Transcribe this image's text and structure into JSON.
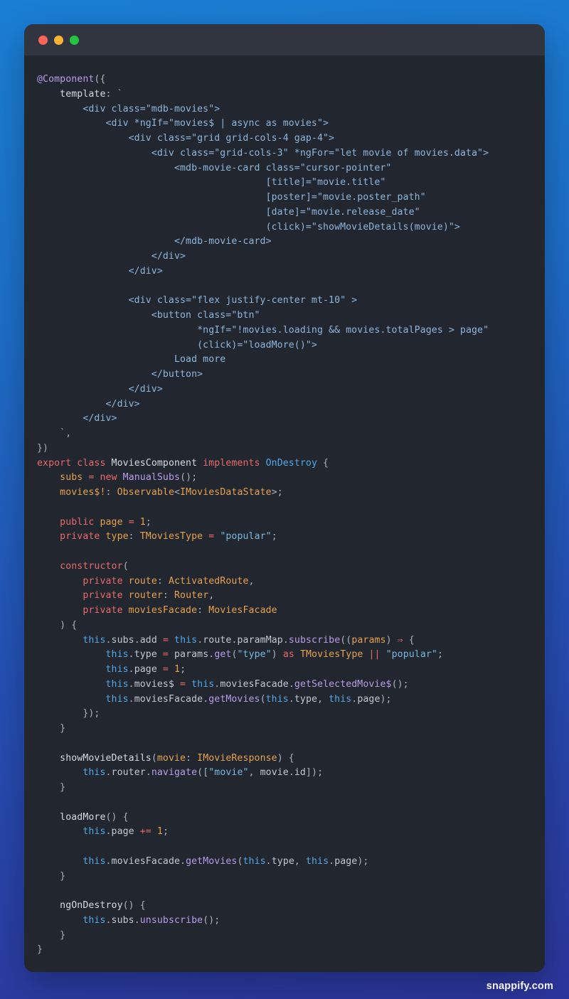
{
  "window": {
    "traffic_lights": [
      {
        "name": "close",
        "color": "#f9655b"
      },
      {
        "name": "minimize",
        "color": "#fab431"
      },
      {
        "name": "maximize",
        "color": "#23c442"
      }
    ]
  },
  "watermark": {
    "text": "snappify.com"
  },
  "theme": {
    "background_top": "#1a7fd4",
    "background_bottom": "#2c359b",
    "card_background": "#22262f",
    "titlebar_background": "#31353f",
    "markup_color": "#8eb6dd",
    "keyword_color": "#e86b6b",
    "class_color": "#52a8e8",
    "variable_color": "#e5a250",
    "function_color": "#b99ce8",
    "string_color": "#79b8e0",
    "plain_color": "#c2c8d4"
  },
  "code": {
    "language": "typescript",
    "filename_hint": "movies.component.ts",
    "plain_text": "@Component({\n    template: `\n        <div class=\"mdb-movies\">\n            <div *ngIf=\"movies$ | async as movies\">\n                <div class=\"grid grid-cols-4 gap-4\">\n                    <div class=\"grid-cols-3\" *ngFor=\"let movie of movies.data\">\n                        <mdb-movie-card class=\"cursor-pointer\"\n                                        [title]=\"movie.title\"\n                                        [poster]=\"movie.poster_path\"\n                                        [date]=\"movie.release_date\"\n                                        (click)=\"showMovieDetails(movie)\">\n                        </mdb-movie-card>\n                    </div>\n                </div>\n\n                <div class=\"flex justify-center mt-10\" >\n                    <button class=\"btn\"\n                            *ngIf=\"!movies.loading && movies.totalPages > page\"\n                            (click)=\"loadMore()\">\n                        Load more\n                    </button>\n                </div>\n            </div>\n        </div>\n    `,\n})\nexport class MoviesComponent implements OnDestroy {\n    subs = new ManualSubs();\n    movies$!: Observable<IMoviesDataState>;\n\n    public page = 1;\n    private type: TMoviesType = \"popular\";\n\n    constructor(\n        private route: ActivatedRoute,\n        private router: Router,\n        private moviesFacade: MoviesFacade\n    ) {\n        this.subs.add = this.route.paramMap.subscribe((params) => {\n            this.type = params.get(\"type\") as TMoviesType || \"popular\";\n            this.page = 1;\n            this.movies$ = this.moviesFacade.getSelectedMovie$();\n            this.moviesFacade.getMovies(this.type, this.page);\n        });\n    }\n\n    showMovieDetails(movie: IMovieResponse) {\n        this.router.navigate([\"movie\", movie.id]);\n    }\n\n    loadMore() {\n        this.page += 1;\n\n        this.moviesFacade.getMovies(this.type, this.page);\n    }\n\n    ngOnDestroy() {\n        this.subs.unsubscribe();\n    }\n}",
    "highlighted_html": "<span class=\"t-fn\">@Component</span><span class=\"t-punc\">({</span>\n    <span class=\"t-def\">template</span><span class=\"t-punc\">:</span> <span class=\"t-str\">`</span>\n        <span class=\"t-html\">&lt;div class=\"mdb-movies\"&gt;</span>\n            <span class=\"t-html\">&lt;div *ngIf=\"movies$ | async as movies\"&gt;</span>\n                <span class=\"t-html\">&lt;div class=\"grid grid-cols-4 gap-4\"&gt;</span>\n                    <span class=\"t-html\">&lt;div class=\"grid-cols-3\" *ngFor=\"let movie of movies.data\"&gt;</span>\n                        <span class=\"t-html\">&lt;mdb-movie-card class=\"cursor-pointer\"</span>\n                                        <span class=\"t-html\">[title]=\"movie.title\"</span>\n                                        <span class=\"t-html\">[poster]=\"movie.poster_path\"</span>\n                                        <span class=\"t-html\">[date]=\"movie.release_date\"</span>\n                                        <span class=\"t-html\">(click)=\"showMovieDetails(movie)\"&gt;</span>\n                        <span class=\"t-html\">&lt;/mdb-movie-card&gt;</span>\n                    <span class=\"t-html\">&lt;/div&gt;</span>\n                <span class=\"t-html\">&lt;/div&gt;</span>\n\n                <span class=\"t-html\">&lt;div class=\"flex justify-center mt-10\" &gt;</span>\n                    <span class=\"t-html\">&lt;button class=\"btn\"</span>\n                            <span class=\"t-html\">*ngIf=\"!movies.loading &amp;&amp; movies.totalPages &gt; page\"</span>\n                            <span class=\"t-html\">(click)=\"loadMore()\"&gt;</span>\n                        <span class=\"t-html\">Load more</span>\n                    <span class=\"t-html\">&lt;/button&gt;</span>\n                <span class=\"t-html\">&lt;/div&gt;</span>\n            <span class=\"t-html\">&lt;/div&gt;</span>\n        <span class=\"t-html\">&lt;/div&gt;</span>\n    <span class=\"t-str\">`</span><span class=\"t-punc\">,</span>\n<span class=\"t-punc\">})</span>\n<span class=\"t-kw\">export</span> <span class=\"t-kw\">class</span> <span class=\"t-def\">MoviesComponent</span> <span class=\"t-kw\">implements</span> <span class=\"t-cls\">OnDestroy</span> <span class=\"t-punc\">{</span>\n    <span class=\"t-var\">subs</span> <span class=\"t-op\">=</span> <span class=\"t-kw\">new</span> <span class=\"t-fn\">ManualSubs</span><span class=\"t-punc\">();</span>\n    <span class=\"t-var\">movies$!</span><span class=\"t-punc\">:</span> <span class=\"t-type\">Observable</span><span class=\"t-punc\">&lt;</span><span class=\"t-type\">IMoviesDataState</span><span class=\"t-punc\">&gt;;</span>\n\n    <span class=\"t-kw\">public</span> <span class=\"t-var\">page</span> <span class=\"t-op\">=</span> <span class=\"t-num\">1</span><span class=\"t-punc\">;</span>\n    <span class=\"t-kw\">private</span> <span class=\"t-var\">type</span><span class=\"t-punc\">:</span> <span class=\"t-type\">TMoviesType</span> <span class=\"t-op\">=</span> <span class=\"t-str\">\"popular\"</span><span class=\"t-punc\">;</span>\n\n    <span class=\"t-kw\">constructor</span><span class=\"t-punc\">(</span>\n        <span class=\"t-kw\">private</span> <span class=\"t-var\">route</span><span class=\"t-punc\">:</span> <span class=\"t-type\">ActivatedRoute</span><span class=\"t-punc\">,</span>\n        <span class=\"t-kw\">private</span> <span class=\"t-var\">router</span><span class=\"t-punc\">:</span> <span class=\"t-type\">Router</span><span class=\"t-punc\">,</span>\n        <span class=\"t-kw\">private</span> <span class=\"t-var\">moviesFacade</span><span class=\"t-punc\">:</span> <span class=\"t-type\">MoviesFacade</span>\n    <span class=\"t-punc\">) {</span>\n        <span class=\"t-this\">this</span><span class=\"t-punc\">.</span><span class=\"t-plain\">subs</span><span class=\"t-punc\">.</span><span class=\"t-plain\">add</span> <span class=\"t-op\">=</span> <span class=\"t-this\">this</span><span class=\"t-punc\">.</span><span class=\"t-plain\">route</span><span class=\"t-punc\">.</span><span class=\"t-plain\">paramMap</span><span class=\"t-punc\">.</span><span class=\"t-fn\">subscribe</span><span class=\"t-punc\">((</span><span class=\"t-var\">params</span><span class=\"t-punc\">)</span> <span class=\"t-op\">&rArr;</span> <span class=\"t-punc\">{</span>\n            <span class=\"t-this\">this</span><span class=\"t-punc\">.</span><span class=\"t-plain\">type</span> <span class=\"t-op\">=</span> <span class=\"t-plain\">params</span><span class=\"t-punc\">.</span><span class=\"t-fn\">get</span><span class=\"t-punc\">(</span><span class=\"t-str\">\"type\"</span><span class=\"t-punc\">)</span> <span class=\"t-op\">as</span> <span class=\"t-type\">TMoviesType</span> <span class=\"t-op\">||</span> <span class=\"t-str\">\"popular\"</span><span class=\"t-punc\">;</span>\n            <span class=\"t-this\">this</span><span class=\"t-punc\">.</span><span class=\"t-plain\">page</span> <span class=\"t-op\">=</span> <span class=\"t-num\">1</span><span class=\"t-punc\">;</span>\n            <span class=\"t-this\">this</span><span class=\"t-punc\">.</span><span class=\"t-plain\">movies$</span> <span class=\"t-op\">=</span> <span class=\"t-this\">this</span><span class=\"t-punc\">.</span><span class=\"t-plain\">moviesFacade</span><span class=\"t-punc\">.</span><span class=\"t-fn\">getSelectedMovie$</span><span class=\"t-punc\">();</span>\n            <span class=\"t-this\">this</span><span class=\"t-punc\">.</span><span class=\"t-plain\">moviesFacade</span><span class=\"t-punc\">.</span><span class=\"t-fn\">getMovies</span><span class=\"t-punc\">(</span><span class=\"t-this\">this</span><span class=\"t-punc\">.</span><span class=\"t-plain\">type</span><span class=\"t-punc\">,</span> <span class=\"t-this\">this</span><span class=\"t-punc\">.</span><span class=\"t-plain\">page</span><span class=\"t-punc\">);</span>\n        <span class=\"t-punc\">});</span>\n    <span class=\"t-punc\">}</span>\n\n    <span class=\"t-def\">showMovieDetails</span><span class=\"t-punc\">(</span><span class=\"t-var\">movie</span><span class=\"t-punc\">:</span> <span class=\"t-type\">IMovieResponse</span><span class=\"t-punc\">) {</span>\n        <span class=\"t-this\">this</span><span class=\"t-punc\">.</span><span class=\"t-plain\">router</span><span class=\"t-punc\">.</span><span class=\"t-fn\">navigate</span><span class=\"t-punc\">([</span><span class=\"t-str\">\"movie\"</span><span class=\"t-punc\">,</span> <span class=\"t-plain\">movie</span><span class=\"t-punc\">.</span><span class=\"t-plain\">id</span><span class=\"t-punc\">]);</span>\n    <span class=\"t-punc\">}</span>\n\n    <span class=\"t-def\">loadMore</span><span class=\"t-punc\">() {</span>\n        <span class=\"t-this\">this</span><span class=\"t-punc\">.</span><span class=\"t-plain\">page</span> <span class=\"t-op\">+=</span> <span class=\"t-num\">1</span><span class=\"t-punc\">;</span>\n\n        <span class=\"t-this\">this</span><span class=\"t-punc\">.</span><span class=\"t-plain\">moviesFacade</span><span class=\"t-punc\">.</span><span class=\"t-fn\">getMovies</span><span class=\"t-punc\">(</span><span class=\"t-this\">this</span><span class=\"t-punc\">.</span><span class=\"t-plain\">type</span><span class=\"t-punc\">,</span> <span class=\"t-this\">this</span><span class=\"t-punc\">.</span><span class=\"t-plain\">page</span><span class=\"t-punc\">);</span>\n    <span class=\"t-punc\">}</span>\n\n    <span class=\"t-def\">ngOnDestroy</span><span class=\"t-punc\">() {</span>\n        <span class=\"t-this\">this</span><span class=\"t-punc\">.</span><span class=\"t-plain\">subs</span><span class=\"t-punc\">.</span><span class=\"t-fn\">unsubscribe</span><span class=\"t-punc\">();</span>\n    <span class=\"t-punc\">}</span>\n<span class=\"t-punc\">}</span>"
  }
}
